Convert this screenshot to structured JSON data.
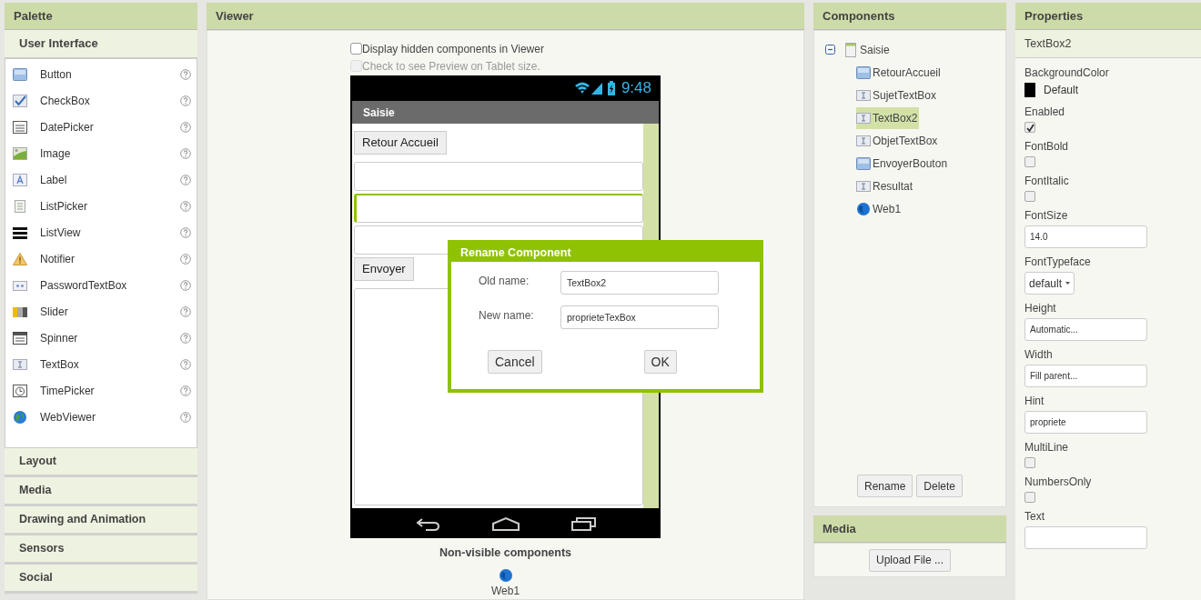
{
  "palette": {
    "title": "Palette",
    "section": {
      "title": "User Interface"
    },
    "items": [
      {
        "kind": "button",
        "label": "Button"
      },
      {
        "kind": "checkbox",
        "label": "CheckBox"
      },
      {
        "kind": "datepicker",
        "label": "DatePicker"
      },
      {
        "kind": "image",
        "label": "Image"
      },
      {
        "kind": "label",
        "label": "Label"
      },
      {
        "kind": "listpicker",
        "label": "ListPicker"
      },
      {
        "kind": "listview",
        "label": "ListView"
      },
      {
        "kind": "notifier",
        "label": "Notifier"
      },
      {
        "kind": "password",
        "label": "PasswordTextBox"
      },
      {
        "kind": "slider",
        "label": "Slider"
      },
      {
        "kind": "spinner",
        "label": "Spinner"
      },
      {
        "kind": "textbox",
        "label": "TextBox"
      },
      {
        "kind": "timepicker",
        "label": "TimePicker"
      },
      {
        "kind": "webviewer",
        "label": "WebViewer"
      }
    ],
    "categories": [
      {
        "label": "Layout"
      },
      {
        "label": "Media"
      },
      {
        "label": "Drawing and Animation"
      },
      {
        "label": "Sensors"
      },
      {
        "label": "Social"
      }
    ]
  },
  "viewer": {
    "title": "Viewer",
    "options": [
      {
        "label": "Display hidden components in Viewer",
        "checked": false,
        "disabled": false
      },
      {
        "label": "Check to see Preview on Tablet size.",
        "checked": false,
        "disabled": true
      }
    ],
    "phone": {
      "time": "9:48",
      "screen_title": "Saisie",
      "components": [
        {
          "kind": "button",
          "label": "Retour Accueil"
        },
        {
          "kind": "textbox",
          "selected": false
        },
        {
          "kind": "textbox",
          "selected": true
        },
        {
          "kind": "textbox",
          "selected": false
        },
        {
          "kind": "button",
          "label": "Envoyer"
        },
        {
          "kind": "multiline",
          "selected": false
        }
      ]
    },
    "non_visible": {
      "title": "Non-visible components",
      "items": [
        {
          "label": "Web1"
        }
      ]
    }
  },
  "dialog": {
    "title": "Rename Component",
    "fields": [
      {
        "label": "Old name:",
        "value": "TextBox2"
      },
      {
        "label": "New name:",
        "value": "proprieteTexBox"
      }
    ],
    "buttons": [
      "Cancel",
      "OK"
    ]
  },
  "components": {
    "title": "Components",
    "tree": [
      {
        "kind": "screen",
        "label": "Saisie",
        "expanded": true,
        "selected": false,
        "children": [
          {
            "kind": "button",
            "label": "RetourAccueil",
            "selected": false
          },
          {
            "kind": "textbox",
            "label": "SujetTextBox",
            "selected": false
          },
          {
            "kind": "textbox",
            "label": "TextBox2",
            "selected": true
          },
          {
            "kind": "textbox",
            "label": "ObjetTextBox",
            "selected": false
          },
          {
            "kind": "button",
            "label": "EnvoyerBouton",
            "selected": false
          },
          {
            "kind": "textbox",
            "label": "Resultat",
            "selected": false
          },
          {
            "kind": "web",
            "label": "Web1",
            "selected": false
          }
        ]
      }
    ],
    "buttons": [
      "Rename",
      "Delete"
    ]
  },
  "media": {
    "title": "Media",
    "button": "Upload File ..."
  },
  "properties": {
    "title": "Properties",
    "component": "TextBox2",
    "items": [
      {
        "kind": "color",
        "label": "BackgroundColor",
        "value": "Default",
        "color": "#000000"
      },
      {
        "kind": "checkbox",
        "label": "Enabled",
        "checked": true
      },
      {
        "kind": "checkbox",
        "label": "FontBold",
        "checked": false
      },
      {
        "kind": "checkbox",
        "label": "FontItalic",
        "checked": false
      },
      {
        "kind": "text",
        "label": "FontSize",
        "value": "14.0"
      },
      {
        "kind": "dropdown",
        "label": "FontTypeface",
        "value": "default"
      },
      {
        "kind": "text",
        "label": "Height",
        "value": "Automatic..."
      },
      {
        "kind": "text",
        "label": "Width",
        "value": "Fill parent..."
      },
      {
        "kind": "text",
        "label": "Hint",
        "value": "propriete"
      },
      {
        "kind": "checkbox",
        "label": "MultiLine",
        "checked": false
      },
      {
        "kind": "checkbox",
        "label": "NumbersOnly",
        "checked": false
      },
      {
        "kind": "text",
        "label": "Text"
      }
    ]
  }
}
